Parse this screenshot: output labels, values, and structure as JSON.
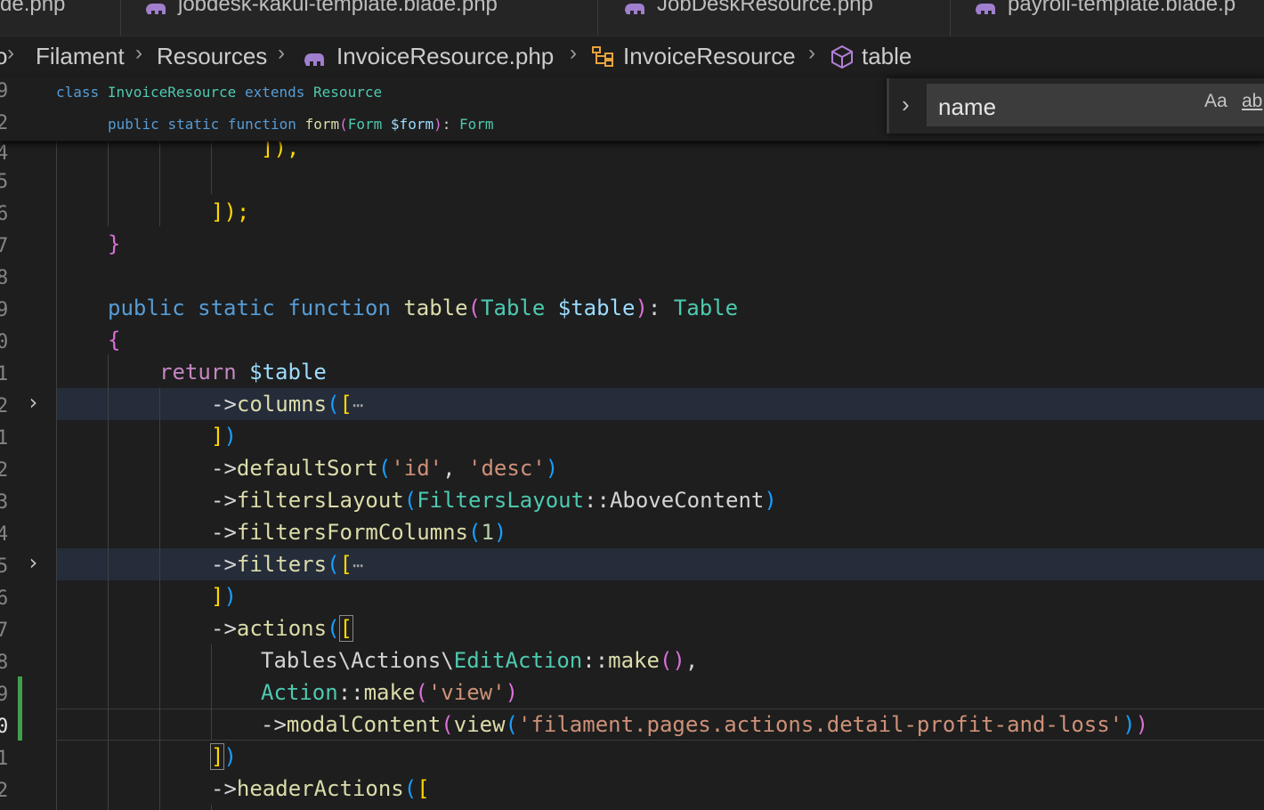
{
  "tabs": [
    {
      "label": "de.php"
    },
    {
      "label": "jobdesk-kakul-template.blade.php"
    },
    {
      "label": "JobDeskResource.php"
    },
    {
      "label": "payroll-template.blade.p"
    }
  ],
  "breadcrumb": {
    "items": [
      "o",
      "Filament",
      "Resources",
      "InvoiceResource.php",
      "InvoiceResource",
      "table"
    ],
    "icons": [
      "php-elephant-icon",
      "class-icon",
      "method-cube-icon"
    ]
  },
  "find_widget": {
    "query": "name",
    "match_case_label": "Aa",
    "whole_word_label": "ab"
  },
  "colors": {
    "background": "#1e1e1e",
    "keyword": "#569cd6",
    "class": "#4ec9b0",
    "function": "#dcdcaa",
    "string": "#ce9178",
    "git_added": "#3fa04b"
  },
  "line_numbers": [
    "9",
    "2",
    "4",
    "5",
    "6",
    "7",
    "8",
    "9",
    "0",
    "1",
    "2",
    "1",
    "2",
    "3",
    "4",
    "5",
    "6",
    "7",
    "8",
    "9",
    "0",
    "1",
    "2"
  ],
  "code": {
    "sticky1": {
      "kw": "class",
      "cls": "InvoiceResource",
      "kw2": "extends",
      "cls2": "Resource"
    },
    "sticky2": {
      "kw1": "public",
      "kw2": "static",
      "kw3": "function",
      "fn": "form",
      "type": "Form",
      "var": "$form",
      "ret": "Form"
    },
    "l_close1": "]),",
    "l_close2": "]);",
    "l_brace_close": "}",
    "l_table_sig": {
      "kw1": "public",
      "kw2": "static",
      "kw3": "function",
      "fn": "table",
      "type": "Table",
      "var": "$table",
      "ret": "Table"
    },
    "l_brace_open": "{",
    "l_return": {
      "kw": "return",
      "var": "$table"
    },
    "l_columns": {
      "arrow": "->",
      "fn": "columns",
      "ellipsis": "⋯"
    },
    "l_close3": "])",
    "l_sort": {
      "arrow": "->",
      "fn": "defaultSort",
      "a1": "'id'",
      "a2": "'desc'"
    },
    "l_layout": {
      "arrow": "->",
      "fn": "filtersLayout",
      "cls": "FiltersLayout",
      "member": "AboveContent"
    },
    "l_formcols": {
      "arrow": "->",
      "fn": "filtersFormColumns",
      "num": "1"
    },
    "l_filters": {
      "arrow": "->",
      "fn": "filters",
      "ellipsis": "⋯"
    },
    "l_close4": "])",
    "l_actions": {
      "arrow": "->",
      "fn": "actions"
    },
    "l_edit": {
      "ns": "Tables\\Actions\\",
      "cls": "EditAction",
      "fn": "make"
    },
    "l_action": {
      "cls": "Action",
      "fn": "make",
      "str": "'view'"
    },
    "l_modal": {
      "arrow": "->",
      "fn": "modalContent",
      "fn2": "view",
      "str": "'filament.pages.actions.detail-profit-and-loss'"
    },
    "l_close5": "])",
    "l_header": {
      "arrow": "->",
      "fn": "headerActions"
    }
  }
}
